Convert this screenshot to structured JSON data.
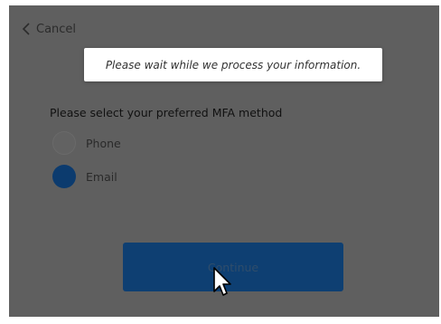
{
  "header": {
    "cancel_label": "Cancel"
  },
  "toast": {
    "message": "Please wait while we process your information."
  },
  "mfa": {
    "heading": "Please select your preferred MFA method",
    "options": [
      {
        "label": "Phone",
        "selected": false
      },
      {
        "label": "Email",
        "selected": true
      }
    ]
  },
  "actions": {
    "continue_label": "Continue"
  },
  "icons": {
    "back": "chevron-left-icon",
    "cursor": "mouse-pointer-icon"
  },
  "colors": {
    "overlay": "#5f5f5f",
    "accent": "#0e3f72",
    "toast_bg": "#ffffff"
  }
}
